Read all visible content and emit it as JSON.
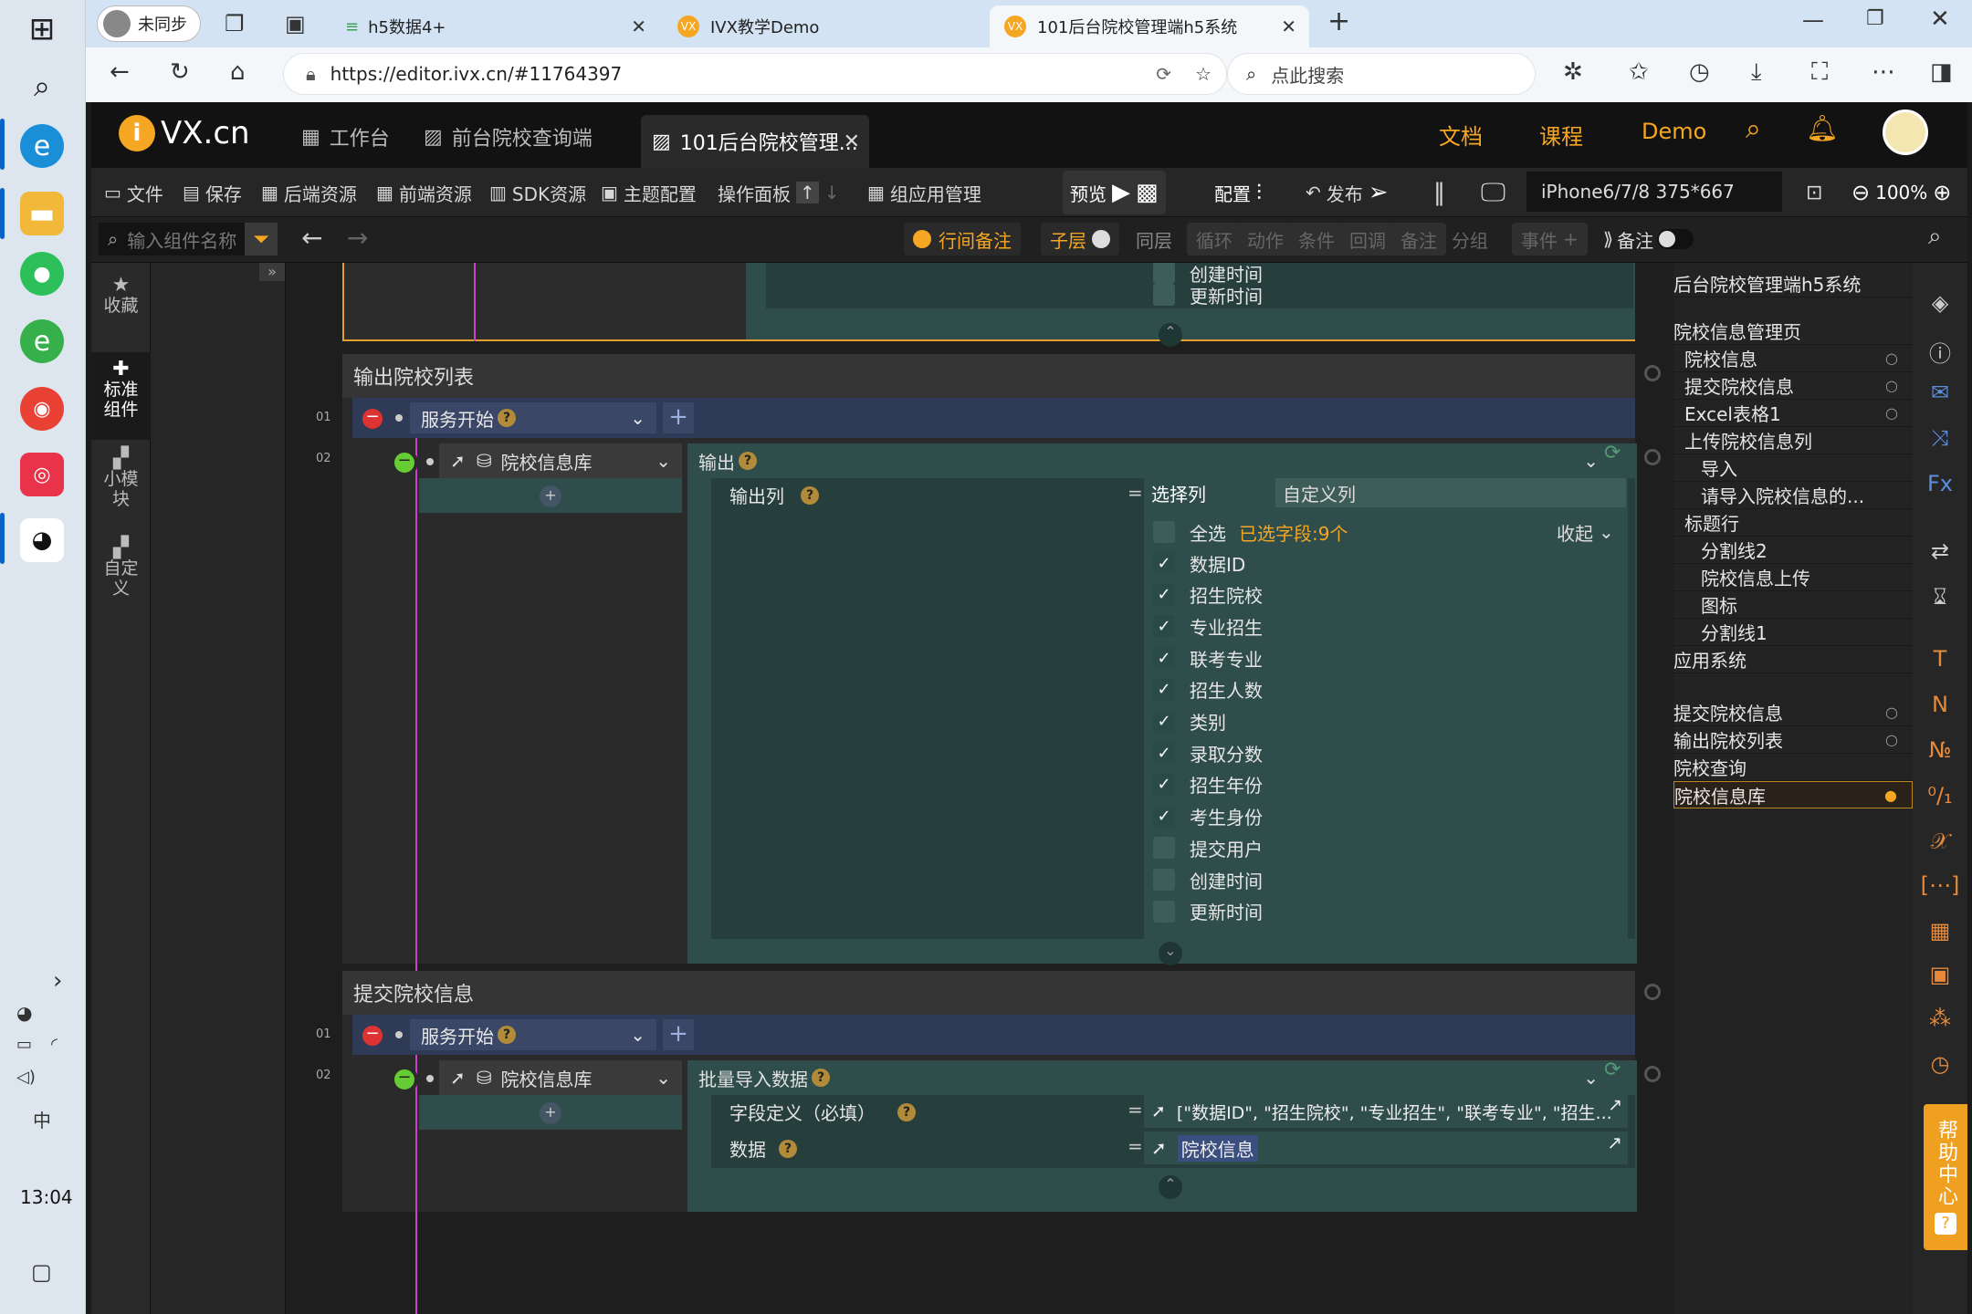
{
  "taskbar": {
    "time": "13:04"
  },
  "browser": {
    "profile": "未同步",
    "tabs": [
      {
        "label": "h5数据4+"
      },
      {
        "label": "IVX教学Demo"
      },
      {
        "label": "101后台院校管理端h5系统"
      }
    ],
    "url": "https://editor.ivx.cn/#11764397",
    "search_placeholder": "点此搜索"
  },
  "app": {
    "logo": "VX.cn",
    "tabs": [
      {
        "label": "工作台"
      },
      {
        "label": "前台院校查询端"
      },
      {
        "label": "101后台院校管理..."
      }
    ],
    "nav": {
      "docs": "文档",
      "course": "课程",
      "demo": "Demo"
    },
    "toolbar": {
      "file": "文件",
      "save": "保存",
      "backend_res": "后端资源",
      "frontend_res": "前端资源",
      "sdk_res": "SDK资源",
      "theme": "主题配置",
      "op_panel": "操作面板",
      "group_app": "组应用管理",
      "preview": "预览",
      "config": "配置",
      "publish": "发布",
      "device": "iPhone6/7/8 375*667",
      "zoom": "100%"
    },
    "toolbar2": {
      "search_placeholder": "输入组件名称",
      "row_note": "行间备注",
      "child": "子层",
      "same": "同层",
      "loop": "循环",
      "action": "动作",
      "condition": "条件",
      "callback": "回调",
      "note": "备注",
      "group": "分组",
      "event": "事件",
      "note2": "备注"
    },
    "side": {
      "fav": "收藏",
      "std": "标准组件",
      "small": "小模块",
      "custom": "自定义"
    }
  },
  "canvas": {
    "top_rows": [
      "创建时间",
      "更新时间"
    ],
    "group1": {
      "title": "输出院校列表",
      "row1": {
        "num": "01",
        "event": "服务开始"
      },
      "row2": {
        "num": "02",
        "target": "院校信息库",
        "action": "输出"
      },
      "output_col_label": "输出列",
      "tab_select": "选择列",
      "tab_custom": "自定义列",
      "select_all": "全选",
      "selected_count": "已选字段:9个",
      "collapse": "收起",
      "fields": [
        {
          "label": "数据ID",
          "checked": true
        },
        {
          "label": "招生院校",
          "checked": true
        },
        {
          "label": "专业招生",
          "checked": true
        },
        {
          "label": "联考专业",
          "checked": true
        },
        {
          "label": "招生人数",
          "checked": true
        },
        {
          "label": "类别",
          "checked": true
        },
        {
          "label": "录取分数",
          "checked": true
        },
        {
          "label": "招生年份",
          "checked": true
        },
        {
          "label": "考生身份",
          "checked": true
        },
        {
          "label": "提交用户",
          "checked": false
        },
        {
          "label": "创建时间",
          "checked": false
        },
        {
          "label": "更新时间",
          "checked": false
        }
      ]
    },
    "group2": {
      "title": "提交院校信息",
      "row1": {
        "num": "01",
        "event": "服务开始"
      },
      "row2": {
        "num": "02",
        "target": "院校信息库",
        "action": "批量导入数据"
      },
      "field_def_label": "字段定义（必填）",
      "field_def_value": "[\"数据ID\", \"招生院校\", \"专业招生\", \"联考专业\", \"招生...",
      "data_label": "数据",
      "data_value": "院校信息"
    }
  },
  "outline": [
    {
      "label": "后台院校管理端h5系统",
      "indent": 0
    },
    {
      "label": "院校信息管理页",
      "indent": 0
    },
    {
      "label": "院校信息",
      "indent": 1,
      "dot": true
    },
    {
      "label": "提交院校信息",
      "indent": 1,
      "dot": true
    },
    {
      "label": "Excel表格1",
      "indent": 1,
      "dot": true
    },
    {
      "label": "上传院校信息列",
      "indent": 1
    },
    {
      "label": "导入",
      "indent": 2
    },
    {
      "label": "请导入院校信息的...",
      "indent": 2
    },
    {
      "label": "标题行",
      "indent": 1
    },
    {
      "label": "分割线2",
      "indent": 2
    },
    {
      "label": "院校信息上传",
      "indent": 2
    },
    {
      "label": "图标",
      "indent": 2
    },
    {
      "label": "分割线1",
      "indent": 2
    },
    {
      "label": "应用系统",
      "indent": 0
    },
    {
      "label": "提交院校信息",
      "indent": 0,
      "dot": true
    },
    {
      "label": "输出院校列表",
      "indent": 0,
      "dot": true
    },
    {
      "label": "院校查询",
      "indent": 0
    },
    {
      "label": "院校信息库",
      "indent": 0,
      "selected": true
    }
  ],
  "help": "帮助中心"
}
